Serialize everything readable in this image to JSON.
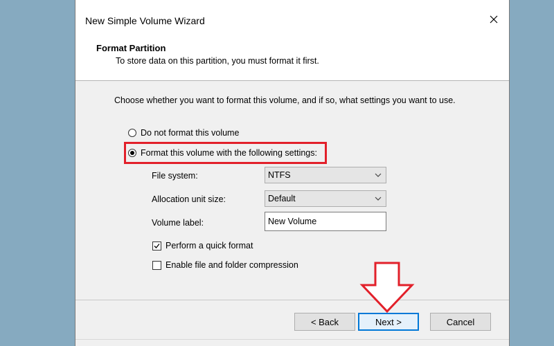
{
  "window": {
    "title": "New Simple Volume Wizard"
  },
  "header": {
    "title": "Format Partition",
    "subtitle": "To store data on this partition, you must format it first."
  },
  "body": {
    "instruction": "Choose whether you want to format this volume, and if so, what settings you want to use.",
    "options": [
      {
        "label": "Do not format this volume",
        "selected": false
      },
      {
        "label": "Format this volume with the following settings:",
        "selected": true
      }
    ],
    "file_system": {
      "label": "File system:",
      "value": "NTFS"
    },
    "allocation_unit": {
      "label": "Allocation unit size:",
      "value": "Default"
    },
    "volume_label": {
      "label": "Volume label:",
      "value": "New Volume"
    },
    "quick_format": {
      "label": "Perform a quick format",
      "checked": true
    },
    "compression": {
      "label": "Enable file and folder compression",
      "checked": false
    }
  },
  "buttons": {
    "back": "< Back",
    "next": "Next >",
    "cancel": "Cancel"
  },
  "colors": {
    "background": "#86aac0",
    "highlight": "#e2202a",
    "primary_border": "#0078d7"
  },
  "icons": {
    "close": "close-icon",
    "dropdown": "chevron-down-icon",
    "check": "checkmark-icon",
    "arrow": "down-arrow-annotation-icon"
  }
}
